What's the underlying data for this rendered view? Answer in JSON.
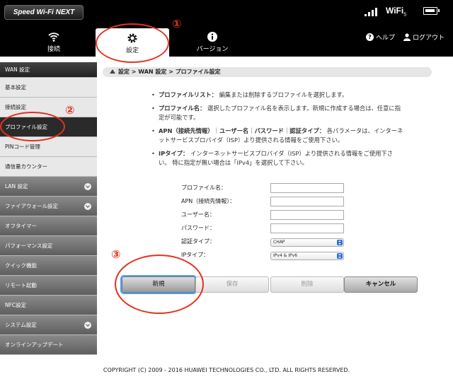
{
  "header": {
    "logo": "Speed Wi-Fi NEXT",
    "wifi_label": "WiFi",
    "wifi_sub": "5"
  },
  "nav": {
    "tabs": [
      {
        "label": "接続",
        "icon": "wifi-icon"
      },
      {
        "label": "設定",
        "icon": "gear-icon"
      },
      {
        "label": "バージョン",
        "icon": "info-icon"
      }
    ],
    "help": "ヘルプ",
    "logout": "ログアウト"
  },
  "sidebar": {
    "header": "WAN 設定",
    "sub_items": [
      "基本設定",
      "接続設定",
      "プロファイル設定",
      "PINコード管理",
      "通信量カウンター"
    ],
    "sections": [
      "LAN 設定",
      "ファイアウォール設定",
      "オフタイマー",
      "パフォーマンス設定",
      "クイック機能",
      "リモート起動",
      "NFC設定",
      "システム設定",
      "オンラインアップデート"
    ]
  },
  "breadcrumb": "設定 > WAN 設定 > プロファイル設定",
  "info": [
    {
      "b": "プロファイルリスト：",
      "t": " 編集または削除するプロファイルを選択します。"
    },
    {
      "b": "プロファイル名：",
      "t": " 選択したプロファイル名を表示します。新規に作成する場合は、任意に指定が可能です。"
    },
    {
      "b": "APN（接続先情報）",
      "t": "｜",
      "b2": "ユーザー名",
      "t2": "｜",
      "b3": "パスワード",
      "t3": "｜",
      "b4": "認証タイプ：",
      "t4": " 各パラメータは、インターネットサービスプロバイダ（ISP）より提供される情報をご使用下さい。"
    },
    {
      "b": "IPタイプ：",
      "t": " インターネットサービスプロバイダ（ISP）より提供される情報をご使用下さい。 特に指定が無い場合は「IPv4」を選択して下さい。"
    }
  ],
  "form": {
    "profile_name": "プロファイル名：",
    "apn": "APN（接続先情報）：",
    "username": "ユーザー名：",
    "password": "パスワード：",
    "auth_type": "認証タイプ：",
    "auth_value": "CHAP",
    "ip_type": "IPタイプ：",
    "ip_value": "IPv4 & IPv6"
  },
  "buttons": {
    "new": "新規",
    "save": "保存",
    "delete": "削除",
    "cancel": "キャンセル"
  },
  "annotations": [
    "①",
    "②",
    "③"
  ],
  "footer": "COPYRIGHT (C) 2009 - 2016 HUAWEI TECHNOLOGIES CO., LTD. ALL RIGHTS RESERVED.",
  "colors": {
    "annotation": "#e3331f",
    "focus": "#4aa0ff",
    "select_arrow": "#2f6fd6"
  }
}
